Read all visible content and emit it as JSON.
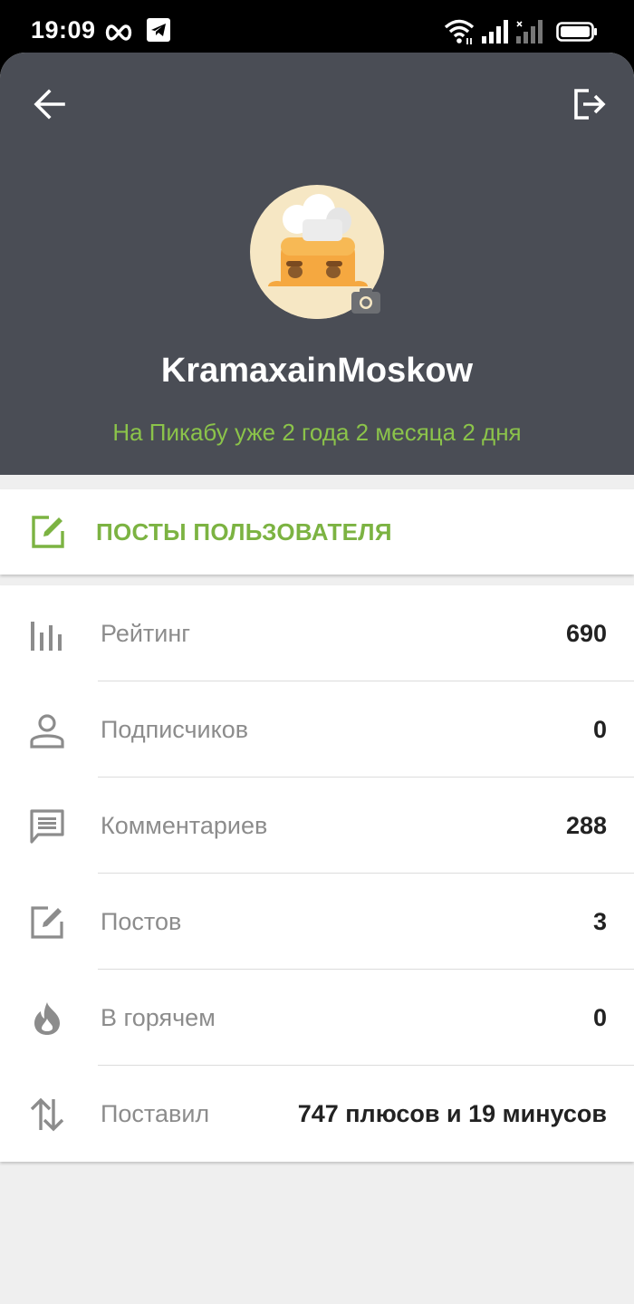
{
  "status_bar": {
    "time": "19:09",
    "left_icons": [
      "infinity-icon",
      "telegram-icon"
    ],
    "right_icons": [
      "wifi-icon",
      "signal-icon",
      "signal-no-service-icon",
      "battery-icon"
    ]
  },
  "header": {
    "background_color": "#4a4d55",
    "back_icon": "arrow-left-icon",
    "logout_icon": "logout-icon",
    "username": "KramaxainMoskow",
    "membership": "На Пикабу уже 2 года 2 месяца 2 дня",
    "membership_color": "#8bc34a",
    "avatar": "chef-avatar",
    "camera_icon": "camera-icon"
  },
  "posts_button": {
    "label": "ПОСТЫ ПОЛЬЗОВАТЕЛЯ",
    "icon": "edit-icon",
    "color": "#7cb342"
  },
  "stats": [
    {
      "icon": "rating-icon",
      "label": "Рейтинг",
      "value": "690"
    },
    {
      "icon": "person-icon",
      "label": "Подписчиков",
      "value": "0"
    },
    {
      "icon": "comment-icon",
      "label": "Комментариев",
      "value": "288"
    },
    {
      "icon": "edit-icon",
      "label": "Постов",
      "value": "3"
    },
    {
      "icon": "flame-icon",
      "label": "В горячем",
      "value": "0"
    },
    {
      "icon": "sort-arrows-icon",
      "label": "Поставил",
      "value": "747 плюсов и 19 минусов"
    }
  ]
}
